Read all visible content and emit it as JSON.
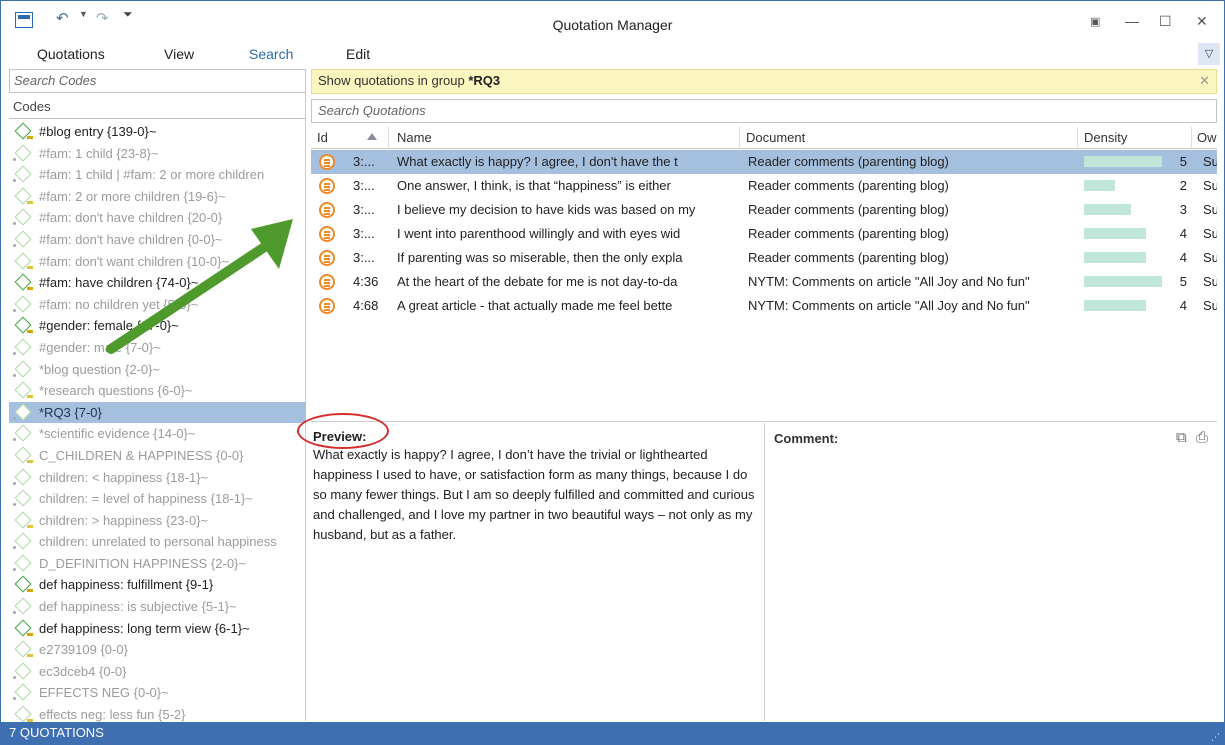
{
  "window": {
    "title": "Quotation Manager"
  },
  "menu": {
    "items": [
      "Quotations",
      "View",
      "Search",
      "Edit"
    ],
    "active": "Search"
  },
  "left": {
    "search_placeholder": "Search Codes",
    "codes_header": "Codes",
    "codes": [
      {
        "label": "#blog entry {139-0}~",
        "dark": true
      },
      {
        "label": "#fam: 1 child {23-8}~",
        "dark": false
      },
      {
        "label": "#fam: 1 child | #fam: 2 or more  children",
        "dark": false
      },
      {
        "label": "#fam: 2 or more  children {19-6}~",
        "dark": false
      },
      {
        "label": "#fam: don't have children {20-0}",
        "dark": false
      },
      {
        "label": "#fam: don't have children {0-0}~",
        "dark": false
      },
      {
        "label": "#fam: don't want children {10-0}~",
        "dark": false
      },
      {
        "label": "#fam: have children {74-0}~",
        "dark": true
      },
      {
        "label": "#fam: no children yet {5-0}~",
        "dark": false
      },
      {
        "label": "#gender: female {67-0}~",
        "dark": true
      },
      {
        "label": "#gender: male {7-0}~",
        "dark": false
      },
      {
        "label": "*blog question {2-0}~",
        "dark": false
      },
      {
        "label": "*research questions {6-0}~",
        "dark": false
      },
      {
        "label": "*RQ3 {7-0}",
        "dark": false,
        "selected": true
      },
      {
        "label": "*scientific evidence {14-0}~",
        "dark": false
      },
      {
        "label": "C_CHILDREN & HAPPINESS {0-0}",
        "dark": false
      },
      {
        "label": "children: < happiness {18-1}~",
        "dark": false
      },
      {
        "label": "children: = level of happiness {18-1}~",
        "dark": false
      },
      {
        "label": "children: > happiness {23-0}~",
        "dark": false
      },
      {
        "label": "children: unrelated to personal happiness",
        "dark": false
      },
      {
        "label": "D_DEFINITION HAPPINESS {2-0}~",
        "dark": false
      },
      {
        "label": "def happiness: fulfillment {9-1}",
        "dark": true
      },
      {
        "label": "def happiness: is subjective {5-1}~",
        "dark": false
      },
      {
        "label": "def happiness: long term view {6-1}~",
        "dark": true
      },
      {
        "label": "e2739109 {0-0}",
        "dark": false
      },
      {
        "label": "ec3dceb4 {0-0}",
        "dark": false
      },
      {
        "label": "EFFECTS NEG {0-0}~",
        "dark": false
      },
      {
        "label": "effects neg: less fun {5-2}",
        "dark": false
      }
    ]
  },
  "group_banner": {
    "prefix": "Show quotations in group ",
    "group": "*RQ3",
    "close": "✕"
  },
  "search_quotations_placeholder": "Search Quotations",
  "table": {
    "columns": [
      "Id",
      "Name",
      "Document",
      "Density",
      "Ow"
    ],
    "rows": [
      {
        "id": "3:...",
        "name": "What exactly is happy? I agree, I don't have the t",
        "document": "Reader comments (parenting blog)",
        "density": 5,
        "owner": "Su",
        "selected": true
      },
      {
        "id": "3:...",
        "name": "One answer, I think, is that “happiness” is either",
        "document": "Reader comments (parenting blog)",
        "density": 2,
        "owner": "Su"
      },
      {
        "id": "3:...",
        "name": "I believe my decision to have kids was based on my",
        "document": "Reader comments (parenting blog)",
        "density": 3,
        "owner": "Su"
      },
      {
        "id": "3:...",
        "name": "I went into parenthood willingly and with eyes wid",
        "document": "Reader comments (parenting blog)",
        "density": 4,
        "owner": "Su"
      },
      {
        "id": "3:...",
        "name": "If parenting was so miserable, then the only expla",
        "document": "Reader comments (parenting blog)",
        "density": 4,
        "owner": "Su"
      },
      {
        "id": "4:36",
        "name": "At the heart of the debate for me is not day-to-da",
        "document": "NYTM: Comments on article \"All Joy and No fun\"",
        "density": 5,
        "owner": "Su"
      },
      {
        "id": "4:68",
        "name": "A great article - that actually made me feel bette",
        "document": "NYTM: Comments on article \"All Joy and No fun\"",
        "density": 4,
        "owner": "Su"
      }
    ]
  },
  "preview": {
    "label": "Preview:",
    "text": "What exactly is happy? I agree, I don’t have the trivial or lighthearted happiness I used to have, or satisfaction form as many things, because I do so many fewer things. But I am so deeply fulfilled and committed and curious and challenged, and I love my partner in two beautiful ways – not only as my husband, but as a father."
  },
  "comment": {
    "label": "Comment:"
  },
  "status": {
    "text": "7 QUOTATIONS"
  },
  "colors": {
    "accent": "#3d6fb1",
    "selection": "#a5bfde",
    "banner": "#fbf5bf",
    "density_bar": "#bfe6d6",
    "quote_icon": "#f08a24",
    "arrow": "#4f9a2c",
    "highlight_circle": "#d62c2c"
  }
}
